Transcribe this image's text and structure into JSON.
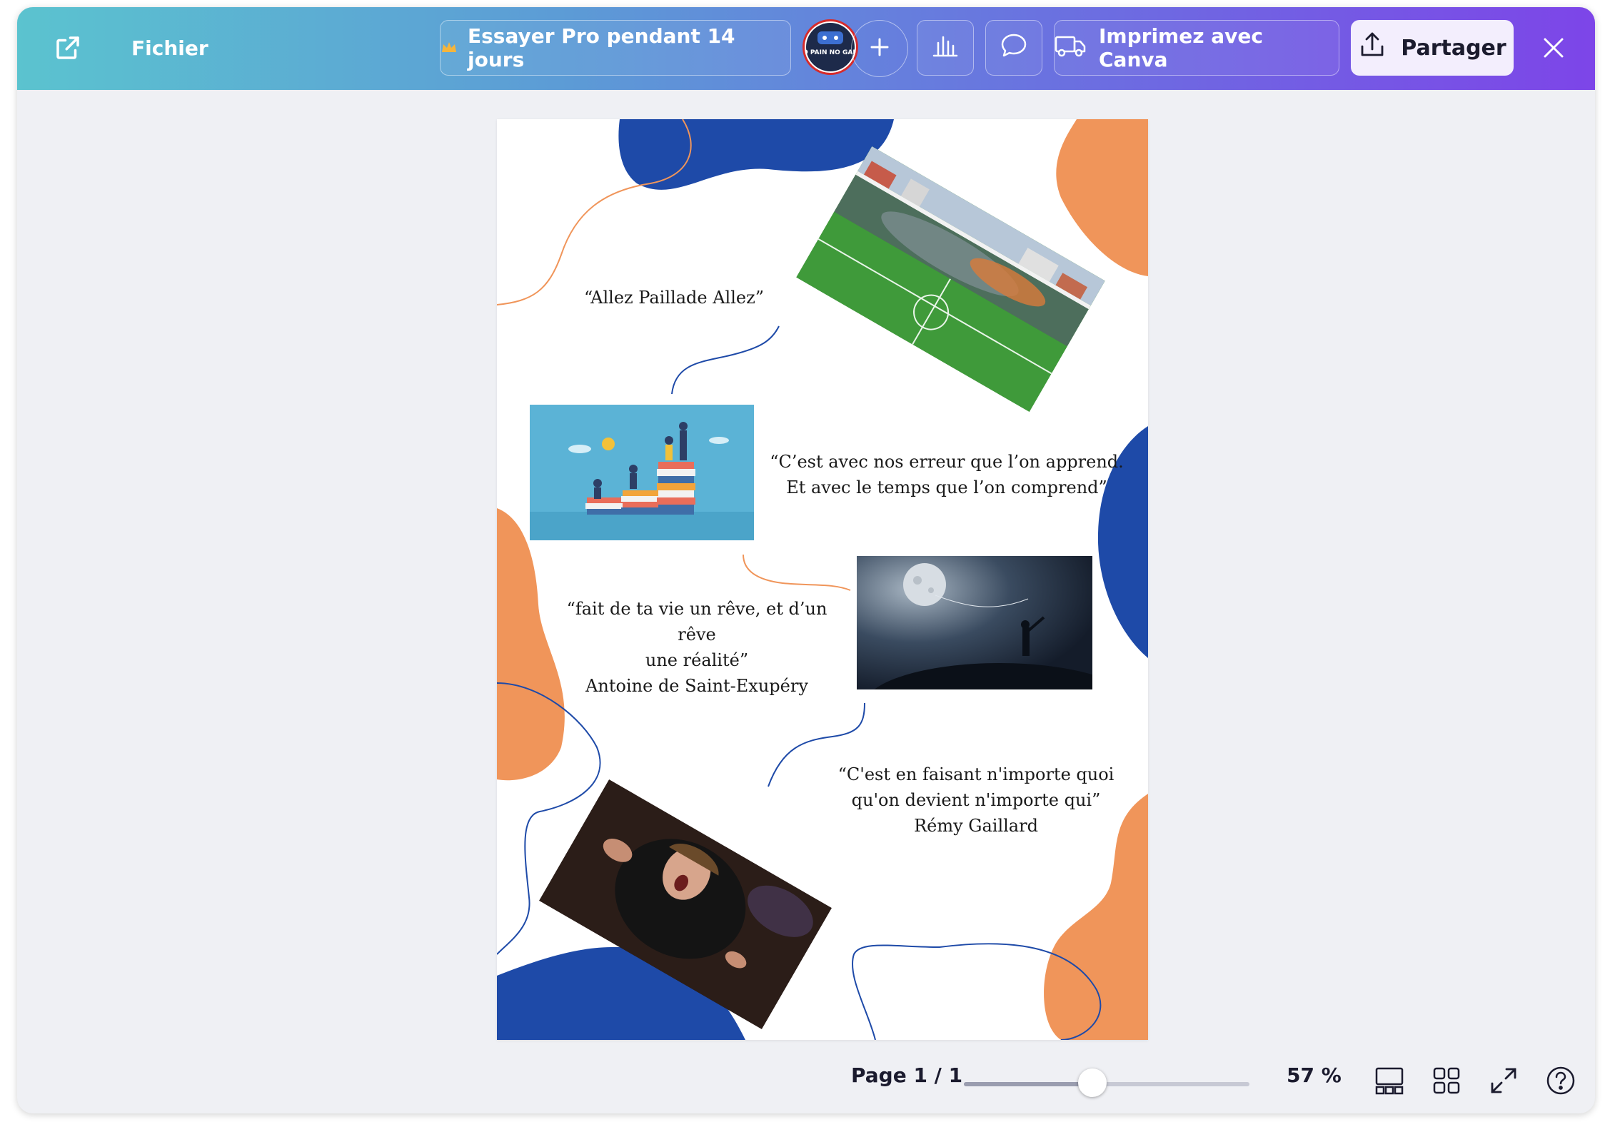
{
  "topbar": {
    "file_label": "Fichier",
    "pro_trial_label": "Essayer Pro pendant 14 jours",
    "print_label": "Imprimez avec Canva",
    "share_label": "Partager",
    "avatar_text": "NO PAIN NO GAME"
  },
  "design": {
    "quotes": [
      {
        "lines": [
          "“Allez Paillade Allez”"
        ]
      },
      {
        "lines": [
          "“C’est avec nos erreur que l’on apprend.",
          "Et avec le temps que l’on comprend”"
        ]
      },
      {
        "lines": [
          "“fait de ta vie un rêve, et d’un rêve",
          "une réalité”",
          "Antoine de Saint-Exupéry"
        ]
      },
      {
        "lines": [
          "“C'est en faisant n'importe quoi",
          "qu'on devient n'importe qui”",
          "Rémy Gaillard"
        ]
      }
    ]
  },
  "footer": {
    "page_indicator": "Page 1 / 1",
    "zoom_label": "57 %",
    "zoom_fraction": 0.45
  },
  "colors": {
    "blue_shape": "#1e4aa8",
    "orange_shape": "#f0955a",
    "topbar_start": "#5bc3cf",
    "topbar_end": "#7d45e8"
  }
}
